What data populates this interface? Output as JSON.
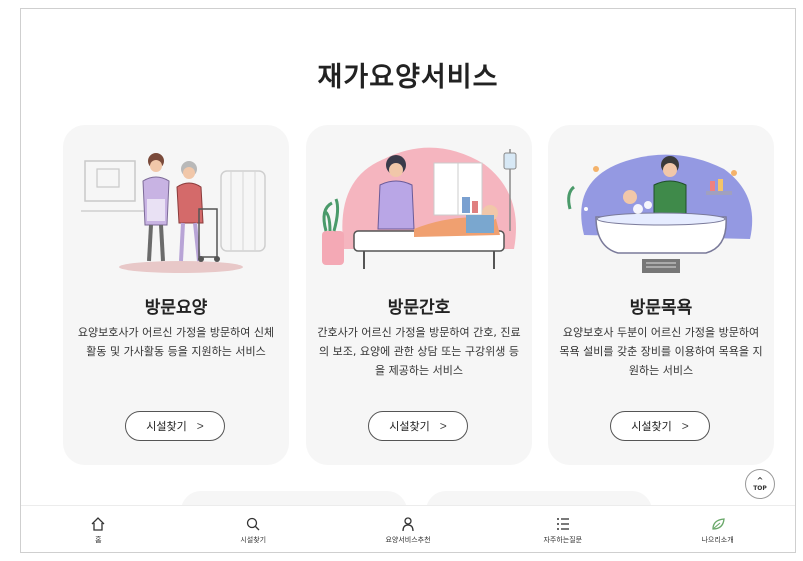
{
  "page": {
    "title": "재가요양서비스"
  },
  "cards": [
    {
      "title": "방문요양",
      "desc": "요양보호사가 어르신 가정을 방문하여 신체활동 및 가사활동 등을 지원하는 서비스",
      "button": "시설찾기",
      "illustration": "caregiver-walking-elder"
    },
    {
      "title": "방문간호",
      "desc": "간호사가 어르신 가정을 방문하여 간호, 진료의 보조, 요양에 관한 상담 또는 구강위생 등을 제공하는 서비스",
      "button": "시설찾기",
      "illustration": "nurse-bedside"
    },
    {
      "title": "방문목욕",
      "desc": "요양보호사 두분이 어르신 가정을 방문하여 목욕 설비를 갖춘 장비를 이용하여 목욕을 지원하는 서비스",
      "button": "시설찾기",
      "illustration": "bathing-service"
    }
  ],
  "top_button": {
    "label": "TOP",
    "icon": "chevron-up-icon"
  },
  "bottom_nav": [
    {
      "label": "홈",
      "icon": "home-icon"
    },
    {
      "label": "시설찾기",
      "icon": "search-icon"
    },
    {
      "label": "요양서비스추천",
      "icon": "person-icon"
    },
    {
      "label": "자주하는질문",
      "icon": "list-icon"
    },
    {
      "label": "나으리소개",
      "icon": "leaf-icon"
    }
  ],
  "colors": {
    "card_bg": "#f6f6f6",
    "nurse_pink": "#f4a9b5",
    "bath_blue": "#8a8fe0",
    "leaf_green": "#6aa86a"
  }
}
